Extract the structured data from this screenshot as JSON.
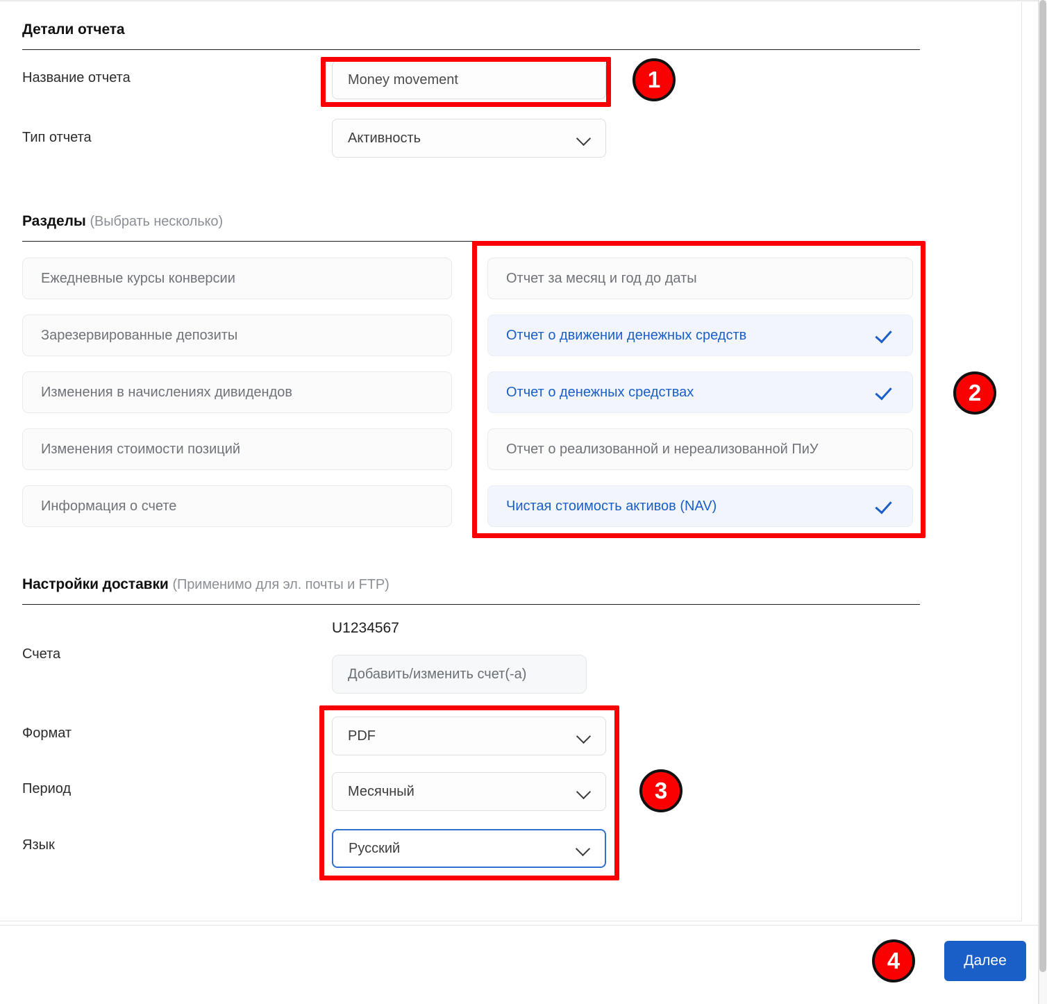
{
  "report_details": {
    "heading": "Детали отчета",
    "name_label": "Название отчета",
    "name_value": "Money movement",
    "type_label": "Тип отчета",
    "type_value": "Активность"
  },
  "sections": {
    "heading": "Разделы",
    "heading_sub": "(Выбрать несколько)",
    "left_column": [
      {
        "label": "Ежедневные курсы конверсии",
        "selected": false
      },
      {
        "label": "Зарезервированные депозиты",
        "selected": false
      },
      {
        "label": "Изменения в начислениях дивидендов",
        "selected": false
      },
      {
        "label": "Изменения стоимости позиций",
        "selected": false
      },
      {
        "label": "Информация о счете",
        "selected": false
      }
    ],
    "right_column": [
      {
        "label": "Отчет за месяц и год до даты",
        "selected": false
      },
      {
        "label": "Отчет о движении денежных средств",
        "selected": true
      },
      {
        "label": "Отчет о денежных средствах",
        "selected": true
      },
      {
        "label": "Отчет о реализованной и нереализованной ПиУ",
        "selected": false
      },
      {
        "label": "Чистая стоимость активов (NAV)",
        "selected": true
      }
    ]
  },
  "delivery": {
    "heading": "Настройки доставки",
    "heading_sub": "(Применимо для эл. почты и FTP)",
    "accounts_label": "Счета",
    "account_id": "U1234567",
    "accounts_button": "Добавить/изменить счет(-а)",
    "format_label": "Формат",
    "format_value": "PDF",
    "period_label": "Период",
    "period_value": "Месячный",
    "language_label": "Язык",
    "language_value": "Русский"
  },
  "footer": {
    "next_label": "Далее"
  },
  "annotations": {
    "badge1": "1",
    "badge2": "2",
    "badge3": "3",
    "badge4": "4"
  },
  "colors": {
    "accent_blue": "#1a5fc8",
    "annotation_red": "#fa0000",
    "selected_bg": "#f2f5fb"
  }
}
